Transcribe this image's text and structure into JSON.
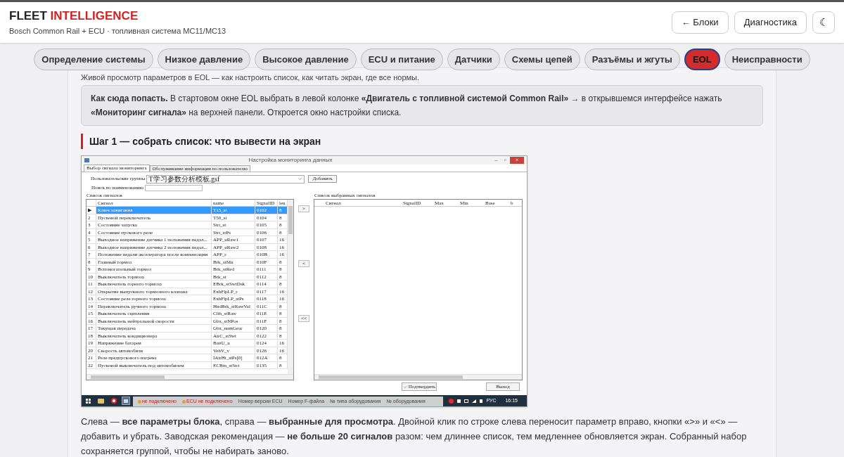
{
  "header": {
    "title": [
      {
        "text": "FLEET ",
        "accent": false
      },
      {
        "text": "INTELLIGENCE",
        "accent": true
      }
    ],
    "subtitle": "Bosch Common Rail + ECU · топливная система MC11/MC13",
    "buttons": [
      {
        "label": "← Блоки",
        "kind": "text"
      },
      {
        "label": "Диагностика",
        "kind": "text"
      },
      {
        "label": "☾",
        "kind": "icon"
      }
    ]
  },
  "nav_tabs": [
    {
      "label": "Определение системы",
      "selected": false
    },
    {
      "label": "Низкое давление",
      "selected": false
    },
    {
      "label": "Высокое давление",
      "selected": false
    },
    {
      "label": "ECU и питание",
      "selected": false
    },
    {
      "label": "Датчики",
      "selected": false
    },
    {
      "label": "Схемы цепей",
      "selected": false
    },
    {
      "label": "Разъёмы и жгуты",
      "selected": false
    },
    {
      "label": "EOL",
      "selected": true
    },
    {
      "label": "Неисправности",
      "selected": false
    }
  ],
  "intro": "Живой просмотр параметров в EOL — как настроить список, как читать экран, где все нормы.",
  "callout": "**Как сюда попасть.** В стартовом окне EOL выбрать в левой колонке **«Двигатель с топливной системой Common Rail»** → в открывшемся интерфейсе нажать **«Мониторинг сигнала»** на верхней панели. Откроется окно настройки списка.",
  "step_heading": "Шаг 1 — собрать список: что вывести на экран",
  "screenshot": {
    "window_title": "Настройка мониторинга данных",
    "window_controls": [
      "–",
      "▫",
      "×"
    ],
    "tabs": [
      {
        "label": "Выбор сигнала мониторинга",
        "selected": true
      },
      {
        "label": "Обслуживание информации по пользователю",
        "selected": false
      }
    ],
    "group_label": "Пользовательские группы",
    "group_value": "T学习参数分析模板.gsf",
    "add_button": "Добавить",
    "search_label": "Поиск по наименованию",
    "left_title": "Список сигналов",
    "left_columns": [
      "Сигнал",
      "name",
      "SignalID",
      "len"
    ],
    "rows": [
      {
        "marker": "▶",
        "signal": "Ключ зажигания",
        "name": "T15_st",
        "id": "0102",
        "len": "8",
        "selected": true
      },
      {
        "marker": "2",
        "signal": "Пусковой переключатель",
        "name": "T50_st",
        "id": "0104",
        "len": "8",
        "selected": false
      },
      {
        "marker": "3",
        "signal": "Состояние запуска",
        "name": "Strt_st",
        "id": "0105",
        "len": "8",
        "selected": false
      },
      {
        "marker": "4",
        "signal": "Состояние пускового реле",
        "name": "Strt_stPs",
        "id": "0106",
        "len": "8",
        "selected": false
      },
      {
        "marker": "5",
        "signal": "Выходное напряжение датчика 1 положения педал...",
        "name": "APP_uRaw1",
        "id": "0107",
        "len": "16",
        "selected": false
      },
      {
        "marker": "6",
        "signal": "Выходное напряжение датчика 2 положения педал...",
        "name": "APP_uRaw2",
        "id": "0108",
        "len": "16",
        "selected": false
      },
      {
        "marker": "7",
        "signal": "Положение педали акселератора после компенсации",
        "name": "APP_r",
        "id": "010B",
        "len": "16",
        "selected": false
      },
      {
        "marker": "8",
        "signal": "Главный тормоз",
        "name": "Brk_stMn",
        "id": "010F",
        "len": "8",
        "selected": false
      },
      {
        "marker": "9",
        "signal": "Вспомогательный тормоз",
        "name": "Brk_stRed",
        "id": "0111",
        "len": "8",
        "selected": false
      },
      {
        "marker": "10",
        "signal": "Выключатель тормоза",
        "name": "Brk_st",
        "id": "0112",
        "len": "8",
        "selected": false
      },
      {
        "marker": "11",
        "signal": "Выключатель горного тормоза",
        "name": "EBrk_stSwtDsk",
        "id": "0114",
        "len": "8",
        "selected": false
      },
      {
        "marker": "12",
        "signal": "Открытие выпускного тормозного клапана",
        "name": "ExhFlpLP_r",
        "id": "0117",
        "len": "16",
        "selected": false
      },
      {
        "marker": "13",
        "signal": "Состояние реле горного тормоза",
        "name": "ExhFlpLP_stPs",
        "id": "0118",
        "len": "16",
        "selected": false
      },
      {
        "marker": "14",
        "signal": "Переключатель ручного тормоза",
        "name": "HndBrk_stRawVal",
        "id": "011C",
        "len": "8",
        "selected": false
      },
      {
        "marker": "15",
        "signal": "Выключатель сцепления",
        "name": "Clth_stRaw",
        "id": "011E",
        "len": "8",
        "selected": false
      },
      {
        "marker": "16",
        "signal": "Выключатель нейтральной скорости",
        "name": "Gbx_stNPos",
        "id": "011F",
        "len": "8",
        "selected": false
      },
      {
        "marker": "17",
        "signal": "Текущая передача",
        "name": "Gbx_numGear",
        "id": "0120",
        "len": "8",
        "selected": false
      },
      {
        "marker": "18",
        "signal": "Выключатель кондиционера",
        "name": "AirC_stSwt",
        "id": "0122",
        "len": "8",
        "selected": false
      },
      {
        "marker": "19",
        "signal": "Напряжение батареи",
        "name": "BattU_u",
        "id": "0124",
        "len": "16",
        "selected": false
      },
      {
        "marker": "20",
        "signal": "Скорость автомобиля",
        "name": "VehV_v",
        "id": "0126",
        "len": "16",
        "selected": false
      },
      {
        "marker": "21",
        "signal": "Реле предпускового нагрева",
        "name": "IAirHt_stPs[0]",
        "id": "012A",
        "len": "8",
        "selected": false
      },
      {
        "marker": "22",
        "signal": "Пусковой выключатель под автомобилем",
        "name": "ECBtn_stStrt",
        "id": "0135",
        "len": "8",
        "selected": false
      }
    ],
    "move_buttons": [
      ">",
      "<",
      "<<"
    ],
    "right_title": "Список выбранных сигналов",
    "right_columns": [
      "Сигнал",
      "SignalID",
      "Max",
      "Min",
      "Base",
      "b"
    ],
    "confirm_button": "Подтвердить",
    "exit_button": "Выход",
    "taskbar_items": [
      {
        "label": "не подключено",
        "kind": "error"
      },
      {
        "label": "ECU не подключено",
        "kind": "error"
      },
      {
        "label": "Номер версии ECU",
        "kind": "info"
      },
      {
        "label": "Номер F-файла",
        "kind": "info"
      },
      {
        "label": "№ типа оборудования",
        "kind": "info"
      },
      {
        "label": "№ оборудования",
        "kind": "info"
      }
    ],
    "language": "РУС",
    "clock": "16:15"
  },
  "paragraph": "Слева — **все параметры блока**, справа — **выбранные для просмотра**. Двойной клик по строке слева переносит параметр вправо, кнопки «>» и «<» — добавить и убрать. Заводская рекомендация — **не больше 20 сигналов** разом: чем длиннее список, тем медленнее обновляется экран. Собранный набор сохраняется группой, чтобы не набирать заново."
}
